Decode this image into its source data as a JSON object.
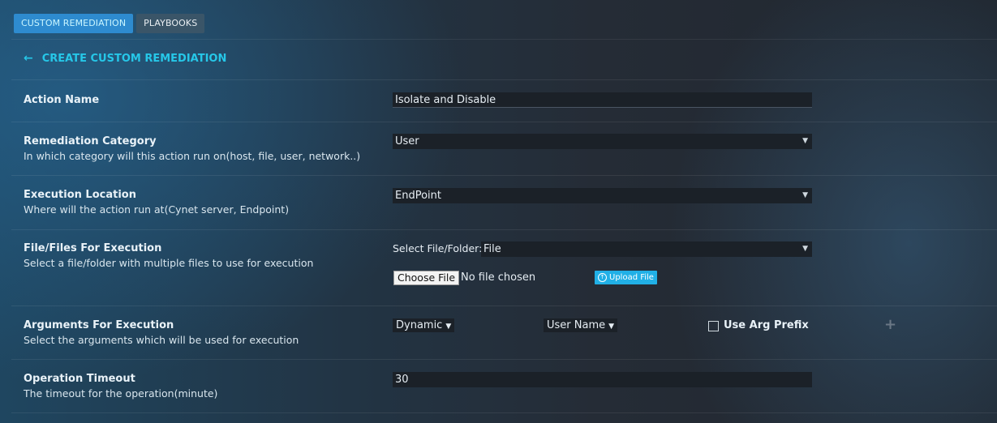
{
  "tabs": [
    {
      "label": "CUSTOM REMEDIATION"
    },
    {
      "label": "PLAYBOOKS"
    }
  ],
  "header": {
    "title": "CREATE CUSTOM REMEDIATION",
    "back_icon": "arrow-left-icon"
  },
  "form": {
    "action_name": {
      "label": "Action Name",
      "value": "Isolate and Disable"
    },
    "category": {
      "label": "Remediation Category",
      "desc": "In which category will this action run on(host, file, user, network..)",
      "value": "User"
    },
    "location": {
      "label": "Execution Location",
      "desc": "Where will the action run at(Cynet server, Endpoint)",
      "value": "EndPoint"
    },
    "files": {
      "label": "File/Files For Execution",
      "desc": "Select a file/folder with multiple files to use for execution",
      "select_label": "Select File/Folder:",
      "select_value": "File",
      "choose_label": "Choose File",
      "no_file": "No file chosen",
      "upload_label": "Upload File"
    },
    "arguments": {
      "label": "Arguments For Execution",
      "desc": "Select the arguments which will be used for execution",
      "type_value": "Dynamic",
      "arg_value": "User Name",
      "prefix_label": "Use Arg Prefix",
      "prefix_checked": false
    },
    "timeout": {
      "label": "Operation Timeout",
      "desc": "The timeout for the operation(minute)",
      "value": "30"
    }
  },
  "colors": {
    "accent": "#26c7e8",
    "active_tab": "#2e8bcf",
    "upload": "#21b0e6"
  }
}
